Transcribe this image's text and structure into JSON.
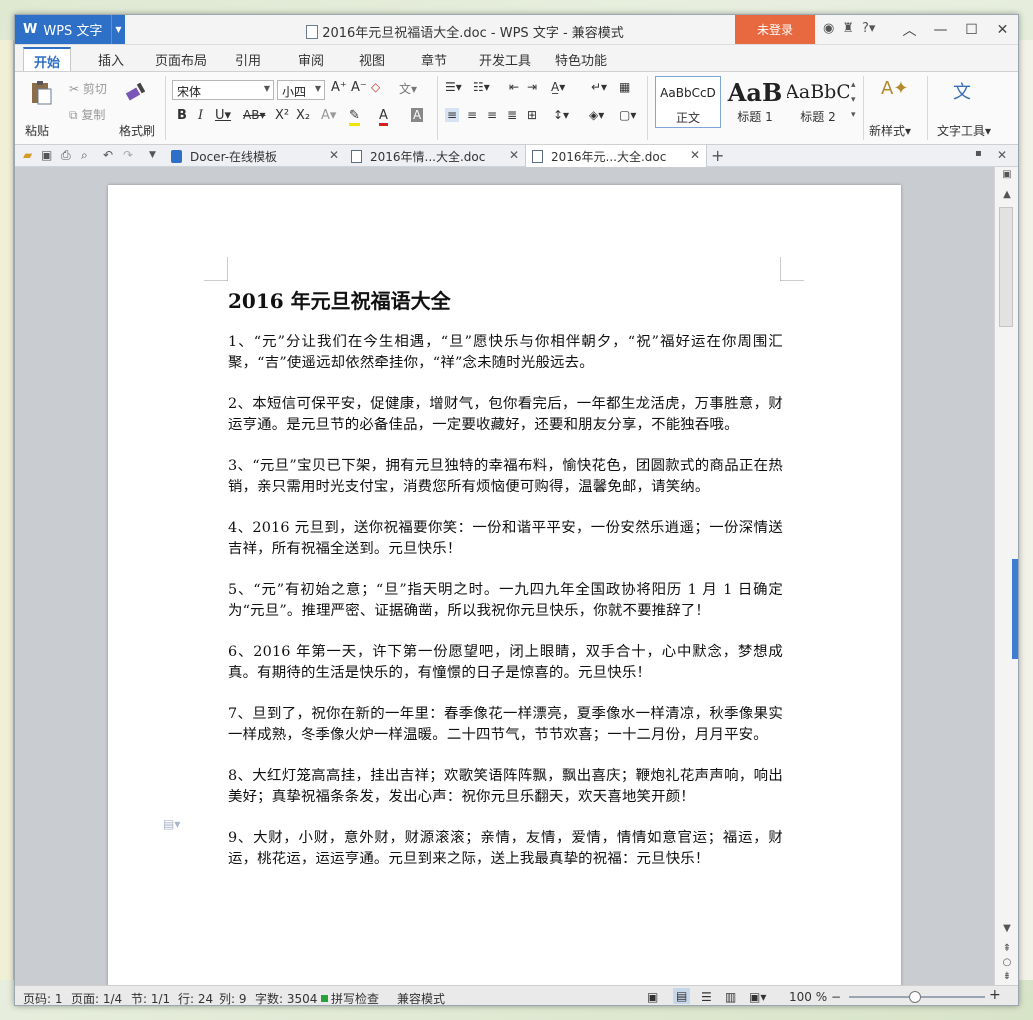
{
  "app": {
    "name": "WPS 文字"
  },
  "titlebar": {
    "doc_title": "2016年元旦祝福语大全.doc - WPS 文字 - 兼容模式",
    "login_label": "未登录"
  },
  "menu": {
    "tabs": [
      "开始",
      "插入",
      "页面布局",
      "引用",
      "审阅",
      "视图",
      "章节",
      "开发工具",
      "特色功能"
    ],
    "active": "开始"
  },
  "ribbon": {
    "paste": "粘贴",
    "cut": "剪切",
    "copy": "复制",
    "format_painter": "格式刷",
    "font_name": "宋体",
    "font_size": "小四",
    "styles": [
      {
        "preview": "AaBbCcD",
        "label": "正文"
      },
      {
        "preview": "AaB",
        "label": "标题 1"
      },
      {
        "preview": "AaBbC",
        "label": "标题 2"
      }
    ],
    "new_style": "新样式",
    "text_tools": "文字工具"
  },
  "doc_tabs": [
    {
      "label": "Docer-在线模板"
    },
    {
      "label": "2016年情...大全.doc"
    },
    {
      "label": "2016年元...大全.doc"
    }
  ],
  "document": {
    "heading": "2016 年元旦祝福语大全",
    "paragraphs": [
      "1、“元”分让我们在今生相遇，“旦”愿快乐与你相伴朝夕，“祝”福好运在你周围汇聚，“吉”使遥远却依然牵挂你，“祥”念未随时光般远去。",
      "2、本短信可保平安，促健康，增财气，包你看完后，一年都生龙活虎，万事胜意，财运亨通。是元旦节的必备佳品，一定要收藏好，还要和朋友分享，不能独吞哦。",
      "3、“元旦”宝贝已下架，拥有元旦独特的幸福布料，愉快花色，团圆款式的商品正在热销，亲只需用时光支付宝，消费您所有烦恼便可购得，温馨免邮，请笑纳。",
      "4、2016 元旦到，送你祝福要你笑：一份和谐平平安，一份安然乐逍遥；一份深情送吉祥，所有祝福全送到。元旦快乐！",
      "5、“元”有初始之意；“旦”指天明之时。一九四九年全国政协将阳历 1 月 1 日确定为“元旦”。推理严密、证据确凿，所以我祝你元旦快乐，你就不要推辞了！",
      "6、2016 年第一天，许下第一份愿望吧，闭上眼睛，双手合十，心中默念，梦想成真。有期待的生活是快乐的，有憧憬的日子是惊喜的。元旦快乐！",
      "7、旦到了，祝你在新的一年里：春季像花一样漂亮，夏季像水一样清凉，秋季像果实一样成熟，冬季像火炉一样温暖。二十四节气，节节欢喜；一十二月份，月月平安。",
      "8、大红灯笼高高挂，挂出吉祥；欢歌笑语阵阵飘，飘出喜庆；鞭炮礼花声声响，响出美好；真挚祝福条条发，发出心声：祝你元旦乐翻天，欢天喜地笑开颜！",
      "9、大财，小财，意外财，财源滚滚；亲情，友情，爱情，情情如意官运；福运，财运，桃花运，运运亨通。元旦到来之际，送上我最真挚的祝福：元旦快乐！"
    ]
  },
  "status": {
    "page_num": "页码: 1",
    "pages": "页面: 1/4",
    "section": "节: 1/1",
    "row": "行: 24",
    "col": "列: 9",
    "word_count": "字数: 3504",
    "spell": "拼写检查",
    "mode": "兼容模式",
    "zoom": "100 %"
  },
  "colors": {
    "accent": "#2e6fc7",
    "login": "#e8683f"
  }
}
